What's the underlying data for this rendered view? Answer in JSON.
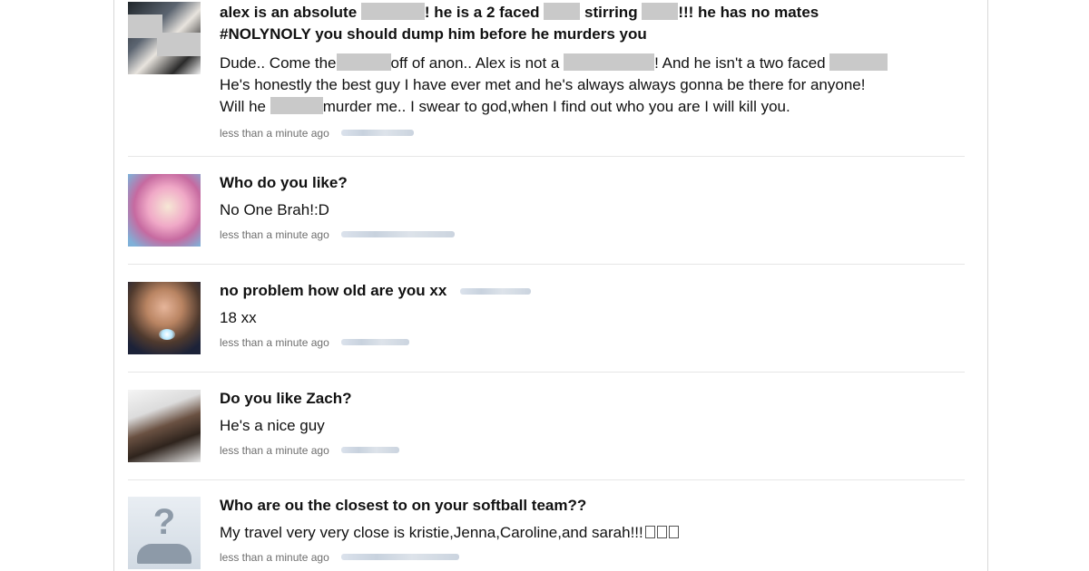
{
  "feed": [
    {
      "question_parts": [
        "alex is an absolute",
        "! he is a 2 faced",
        "stirring",
        "!!! he has no mates",
        "#NOLYNOLY you should dump him before he murders you"
      ],
      "answer_parts": [
        "Dude.. Come the",
        "off of anon.. Alex is not a",
        "! And he isn't a two faced",
        "He's honestly the best guy I have ever met and he's always always gonna be there for anyone!",
        "Will he",
        "murder me.. I swear to god,when I find out who you are I will kill you."
      ],
      "time": "less than a minute ago"
    },
    {
      "question": "Who do you like?",
      "answer": "No One Brah!:D",
      "time": "less than a minute ago"
    },
    {
      "question": "no problem how old are you xx",
      "answer": "18 xx",
      "time": "less than a minute ago"
    },
    {
      "question": "Do you like Zach?",
      "answer": "He's a nice guy",
      "time": "less than a minute ago"
    },
    {
      "question": "Who are ou the closest to on your softball team??",
      "answer": "My travel very very close is kristie,Jenna,Caroline,and sarah!!!",
      "time": "less than a minute ago"
    }
  ],
  "default_avatar_symbol": "?",
  "colors": {
    "text": "#111111",
    "meta": "#6e6e6e",
    "redaction": "#c9c9c9",
    "separator": "#e6e6e6"
  }
}
